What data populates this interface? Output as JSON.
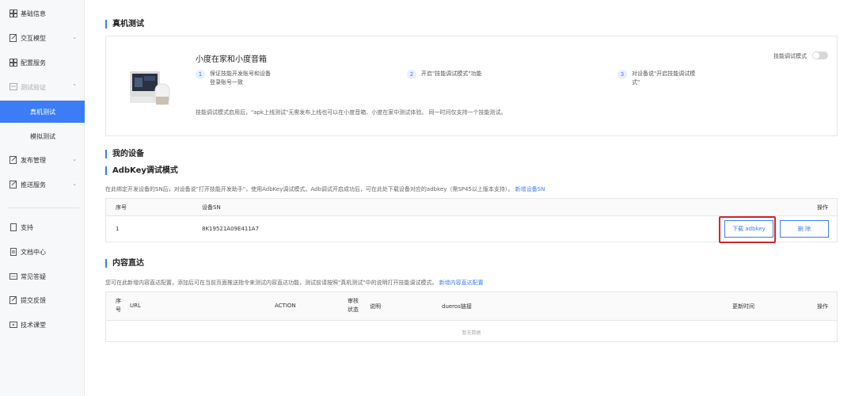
{
  "sidebar": {
    "items": [
      {
        "label": "基础信息"
      },
      {
        "label": "交互模型"
      },
      {
        "label": "配置服务"
      },
      {
        "label": "测试验证"
      },
      {
        "label": "真机测试"
      },
      {
        "label": "模拟测试"
      },
      {
        "label": "发布管理"
      },
      {
        "label": "推送服务"
      },
      {
        "label": "支持"
      },
      {
        "label": "文档中心"
      },
      {
        "label": "常见答疑"
      },
      {
        "label": "提交反馈"
      },
      {
        "label": "技术课堂"
      }
    ]
  },
  "real_test": {
    "section_title": "真机测试",
    "card_title": "小度在家和小度音箱",
    "toggle_label": "技能调试模式",
    "steps": [
      {
        "num": "1",
        "text_line1": "保证技能开发账号和设备",
        "text_line2": "登录账号一致"
      },
      {
        "num": "2",
        "text_line1": "开启\"技能调试模式\"功能",
        "text_line2": ""
      },
      {
        "num": "3",
        "text_line1": "对设备说\"开启技能调试模",
        "text_line2": "式\""
      }
    ],
    "note": "技能调试模式启用后，\"apk上线测试\"无需发布上线也可以在小度音箱、小度在家中测试体验。 同一时间仅支持一个技能测试。"
  },
  "my_devices": {
    "section_title": "我的设备",
    "subsection_title": "AdbKey调试模式",
    "description": "在此绑定开发设备的SN后，对设备说\"打开技能开发助手\"，使用AdbKey调试模式。Adb调试开启成功后，可在此处下载设备对应的adbkey（需SP45以上版本支持）。",
    "add_link": "新增设备SN",
    "headers": {
      "index": "序号",
      "sn": "设备SN",
      "actions": "操作"
    },
    "rows": [
      {
        "index": "1",
        "sn": "8K19521A09E411A7",
        "download_label": "下载 adbkey",
        "delete_label": "删 除"
      }
    ]
  },
  "content_direct": {
    "section_title": "内容直达",
    "description": "您可在此新增内容直达配置，添加后可在当前页面推送指令来测试内容直达功能，测试前请按照\"真机测试\"中的说明打开技能调试模式。",
    "add_link": "新增内容直达配置",
    "headers": {
      "index_line1": "序",
      "index_line2": "号",
      "url": "URL",
      "action": "ACTION",
      "review_line1": "审核",
      "review_line2": "状态",
      "explain": "说明",
      "dueros": "dueros链接",
      "updated": "更新时间",
      "actions": "操作"
    },
    "empty_text": "暂无数据"
  },
  "colors": {
    "accent": "#3c7cf6",
    "highlight": "#d0262d"
  }
}
